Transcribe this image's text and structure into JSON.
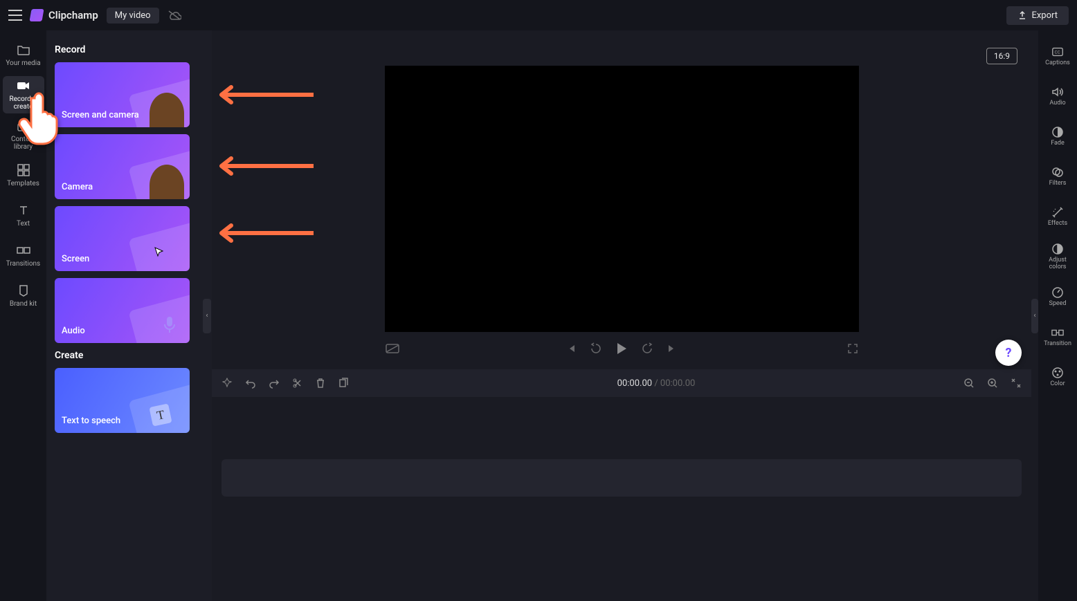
{
  "app": {
    "name": "Clipchamp",
    "project": "My video",
    "export": "Export",
    "aspect": "16:9"
  },
  "sidebar": {
    "items": [
      {
        "label": "Your media"
      },
      {
        "label": "Record & create"
      },
      {
        "label": "Content library"
      },
      {
        "label": "Templates"
      },
      {
        "label": "Text"
      },
      {
        "label": "Transitions"
      },
      {
        "label": "Brand kit"
      }
    ]
  },
  "panel": {
    "section1": "Record",
    "section2": "Create",
    "cards": {
      "screen_camera": "Screen and camera",
      "camera": "Camera",
      "screen": "Screen",
      "audio": "Audio",
      "tts": "Text to speech"
    }
  },
  "time": {
    "current": "00:00.00",
    "duration": "00:00.00"
  },
  "rightbar": {
    "items": [
      {
        "label": "Captions"
      },
      {
        "label": "Audio"
      },
      {
        "label": "Fade"
      },
      {
        "label": "Filters"
      },
      {
        "label": "Effects"
      },
      {
        "label": "Adjust colors"
      },
      {
        "label": "Speed"
      },
      {
        "label": "Transition"
      },
      {
        "label": "Color"
      }
    ]
  },
  "help": "?"
}
